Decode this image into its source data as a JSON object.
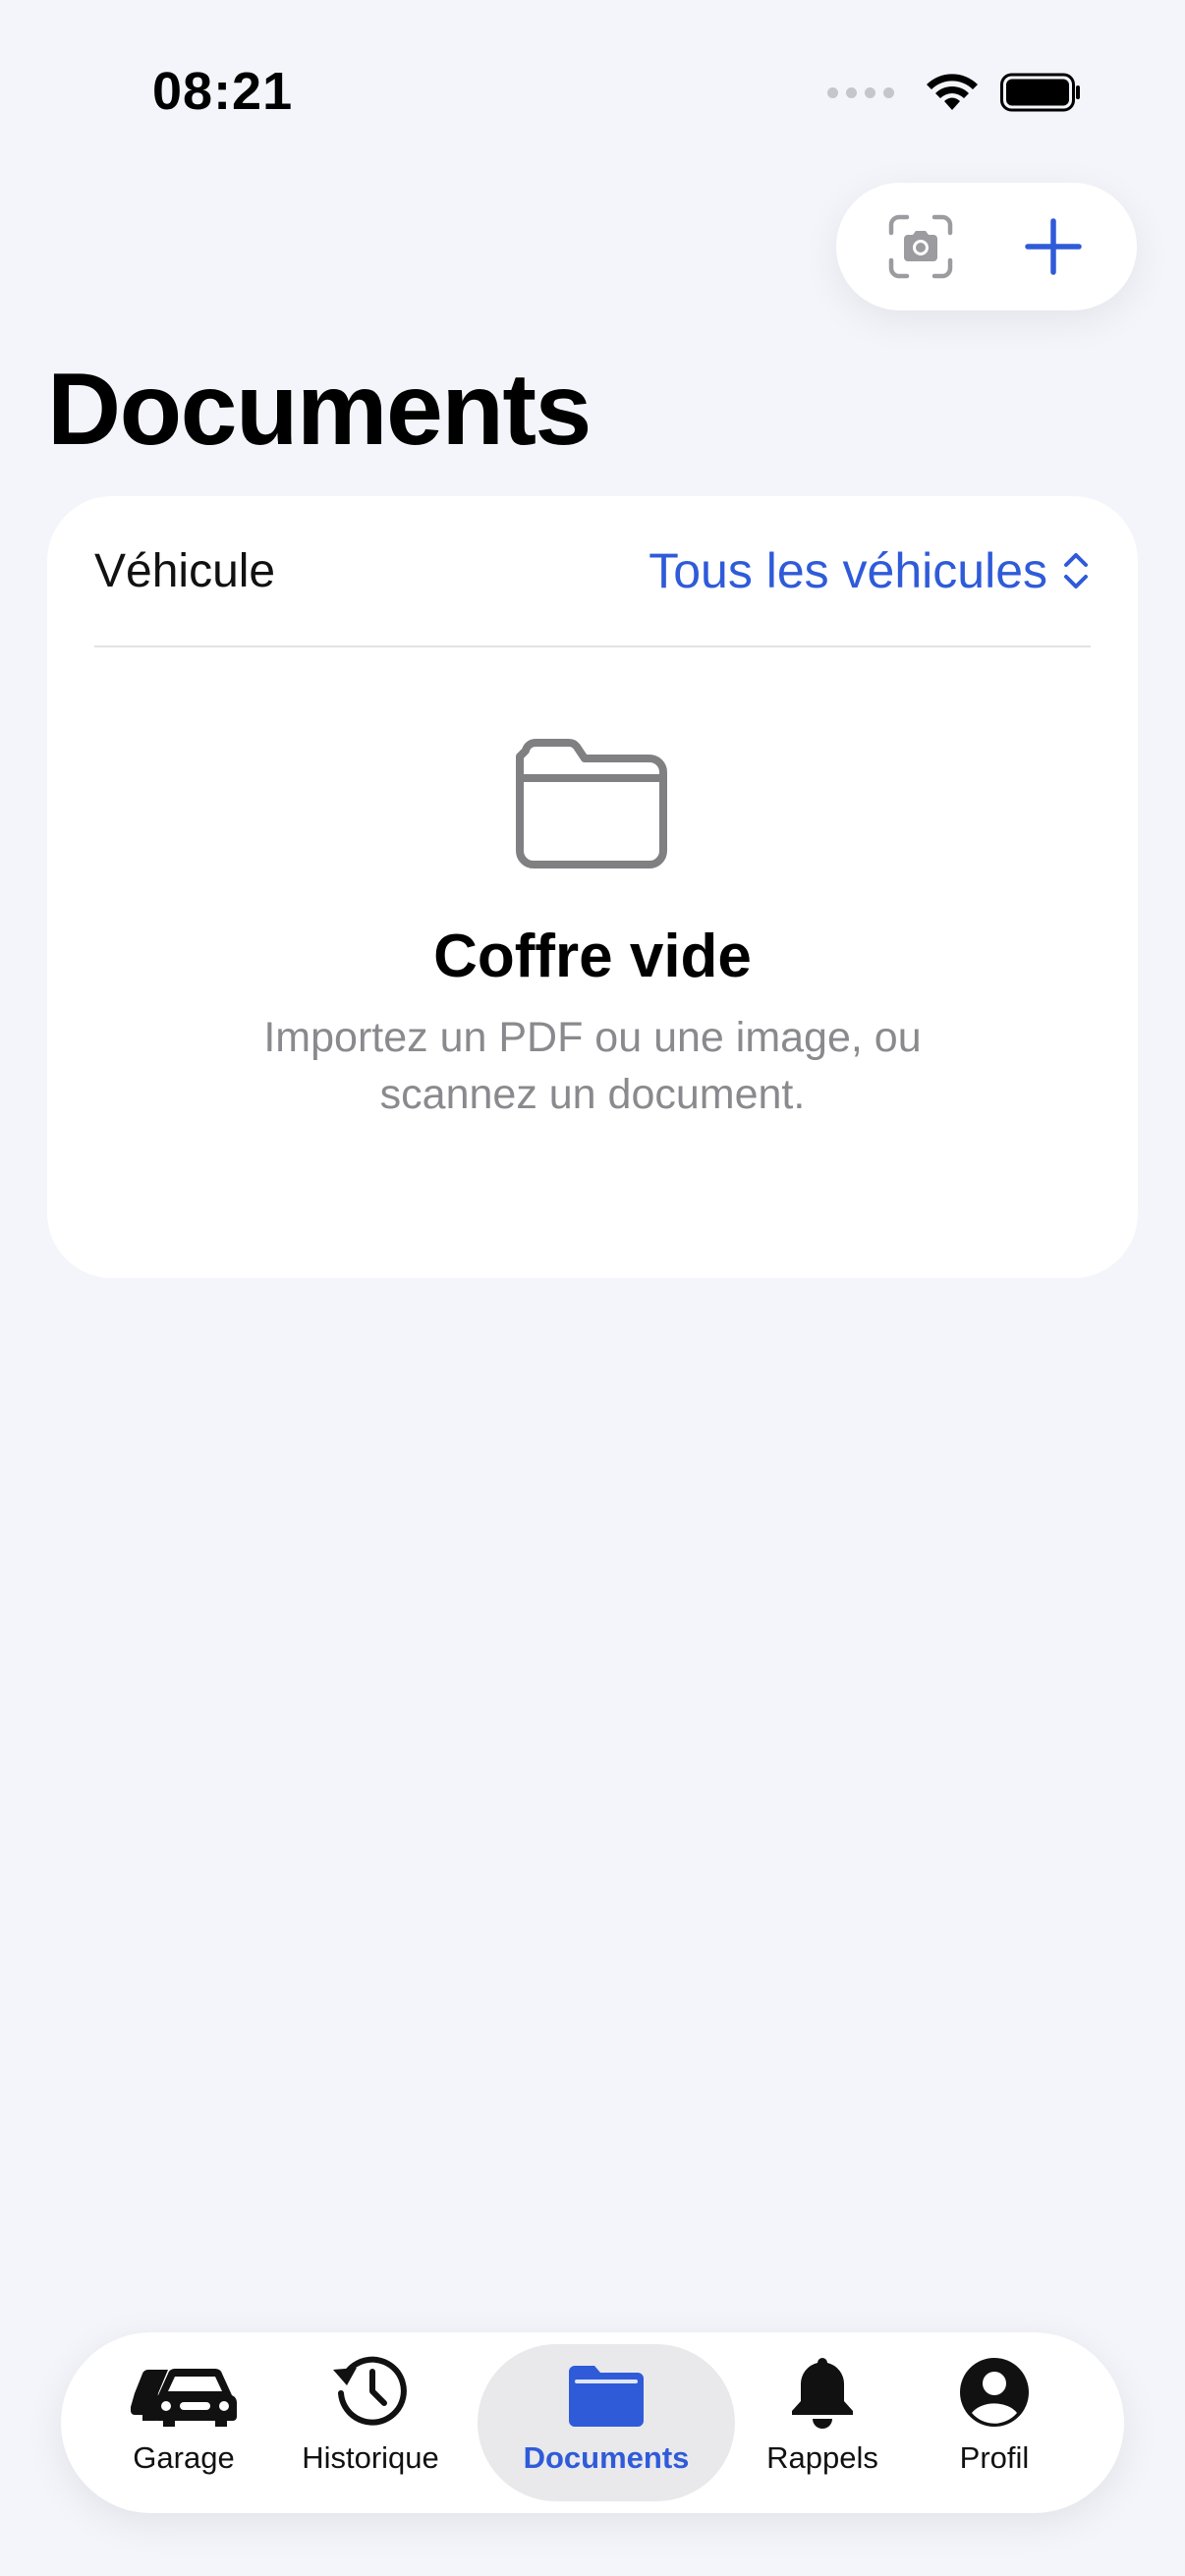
{
  "status_bar": {
    "time": "08:21"
  },
  "toolbar": {
    "scan_icon": "camera-scan-icon",
    "add_icon": "plus-icon"
  },
  "page": {
    "title": "Documents"
  },
  "filter": {
    "label": "Véhicule",
    "selected": "Tous les véhicules"
  },
  "empty_state": {
    "icon": "folder-icon",
    "title": "Coffre vide",
    "description": "Importez un PDF ou une image, ou scannez un document."
  },
  "tab_bar": {
    "items": [
      {
        "label": "Garage",
        "icon": "car-icon",
        "active": false
      },
      {
        "label": "Historique",
        "icon": "history-icon",
        "active": false
      },
      {
        "label": "Documents",
        "icon": "folder-icon",
        "active": true
      },
      {
        "label": "Rappels",
        "icon": "bell-icon",
        "active": false
      },
      {
        "label": "Profil",
        "icon": "person-icon",
        "active": false
      }
    ]
  },
  "colors": {
    "accent": "#2f5bd9",
    "background": "#f4f5fa",
    "secondary_text": "#8a8a8e"
  }
}
